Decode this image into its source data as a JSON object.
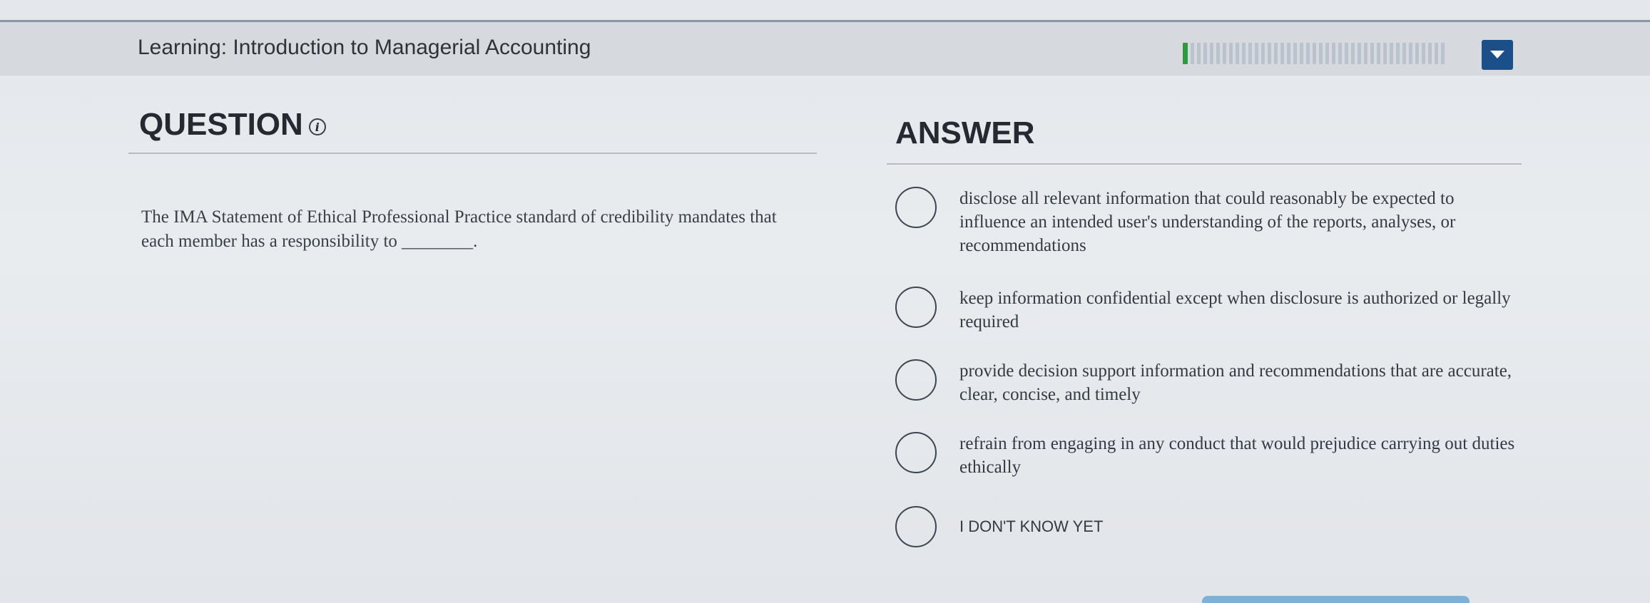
{
  "header": {
    "module_title": "Learning: Introduction to Managerial Accounting",
    "progress": {
      "completed": 1,
      "total": 41
    },
    "menu_icon": "caret-down-icon"
  },
  "question": {
    "heading": "QUESTION",
    "info_icon": "i",
    "text": "The IMA Statement of Ethical Professional Practice standard of credibility mandates that each member has a responsibility to ________."
  },
  "answer": {
    "heading": "ANSWER",
    "options": [
      {
        "label": "disclose all relevant information that could reasonably be expected to influence an intended user's understanding of the reports, analyses, or recommendations"
      },
      {
        "label": "keep information confidential except when disclosure is authorized or legally required"
      },
      {
        "label": "provide decision support information and recommendations that are accurate, clear, concise, and timely"
      },
      {
        "label": "refrain from engaging in any conduct that would prejudice carrying out duties ethically"
      },
      {
        "label": "I DON'T KNOW YET"
      }
    ]
  },
  "colors": {
    "progress_done": "#2e9a3f",
    "progress_todo": "#b9c2cd",
    "menu_button": "#1b4f8a"
  }
}
